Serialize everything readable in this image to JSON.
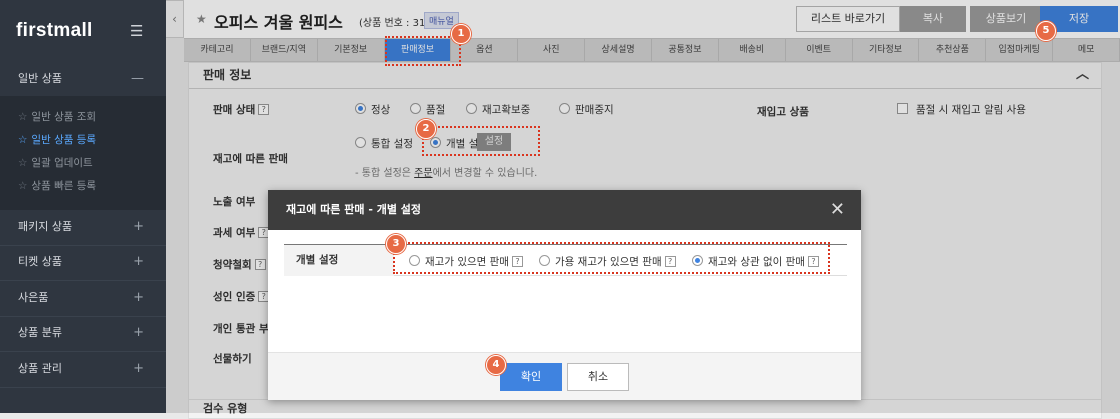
{
  "sidebar": {
    "logo": "firstmall",
    "menu_icon": "☰",
    "sections": [
      {
        "label": "일반 상품",
        "toggle": "—"
      },
      {
        "label": "패키지 상품",
        "toggle": "+"
      },
      {
        "label": "티켓 상품",
        "toggle": "+"
      },
      {
        "label": "사은품",
        "toggle": "+"
      },
      {
        "label": "상품 분류",
        "toggle": "+"
      },
      {
        "label": "상품 관리",
        "toggle": "+"
      }
    ],
    "sub_items": [
      {
        "label": "일반 상품 조회"
      },
      {
        "label": "일반 상품 등록"
      },
      {
        "label": "일괄 업데이트"
      },
      {
        "label": "상품 빠른 등록"
      }
    ],
    "collapse_icon": "‹"
  },
  "header": {
    "title": "오피스 겨울 원피스",
    "product_no": "(상품 번호 : 31)",
    "manual_badge": "매뉴얼",
    "buttons": {
      "list": "리스트 바로가기",
      "copy": "복사",
      "view": "상품보기",
      "save": "저장"
    }
  },
  "tabs": [
    "카테고리",
    "브랜드/지역",
    "기본정보",
    "판매정보",
    "옵션",
    "사진",
    "상세설명",
    "공통정보",
    "배송비",
    "이벤트",
    "기타정보",
    "추천상품",
    "입점마케팅",
    "메모"
  ],
  "active_tab": "판매정보",
  "sales_panel": {
    "title": "판매 정보",
    "collapse": "︿",
    "sale_status_label": "판매 상태",
    "status_options": [
      "정상",
      "품절",
      "재고확보중",
      "판매중지"
    ],
    "restock_label": "재입고 상품",
    "restock_option": "품절 시 재입고 알림 사용",
    "stock_sale_label": "재고에 따른 판매",
    "stock_options": [
      "통합 설정",
      "개별 설정"
    ],
    "set_button": "설정",
    "hint_prefix": "-  통합 설정은 ",
    "hint_link": "주문",
    "hint_suffix": "에서 변경할 수 있습니다.",
    "other_rows": [
      "노출 여부",
      "과세 여부",
      "청약철회",
      "성인 인증",
      "개인 통관 부호",
      "선물하기"
    ],
    "next_section": "검수 유형"
  },
  "modal": {
    "title": "재고에 따른 판매 - 개별 설정",
    "close": "✕",
    "row_label": "개별 설정",
    "options": [
      "재고가 있으면 판매",
      "가용 재고가 있으면 판매",
      "재고와 상관 없이 판매"
    ],
    "selected_index": 2,
    "ok": "확인",
    "cancel": "취소"
  },
  "badges": [
    "1",
    "2",
    "3",
    "4",
    "5"
  ],
  "colors": {
    "accent": "#3f83e0",
    "sidebar": "#2f3640",
    "highlight": "#d9341e",
    "badge": "#e76a45"
  }
}
